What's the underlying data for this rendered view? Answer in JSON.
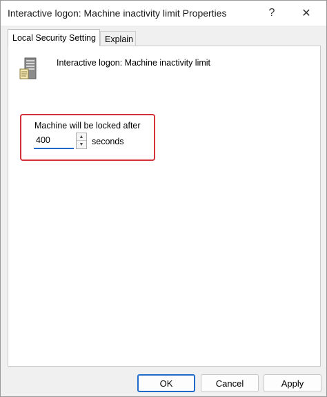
{
  "window": {
    "title": "Interactive logon: Machine inactivity limit Properties",
    "help_glyph": "?",
    "close_glyph": "✕"
  },
  "tabs": [
    {
      "label": "Local Security Setting",
      "active": true
    },
    {
      "label": "Explain",
      "active": false
    }
  ],
  "policy": {
    "name": "Interactive logon: Machine inactivity limit",
    "icon": "server-policy-icon"
  },
  "setting": {
    "label": "Machine will be locked after",
    "value": "400",
    "unit": "seconds"
  },
  "buttons": {
    "ok": "OK",
    "cancel": "Cancel",
    "apply": "Apply"
  },
  "colors": {
    "highlight": "#d3303a",
    "accent": "#1f6ac9"
  }
}
